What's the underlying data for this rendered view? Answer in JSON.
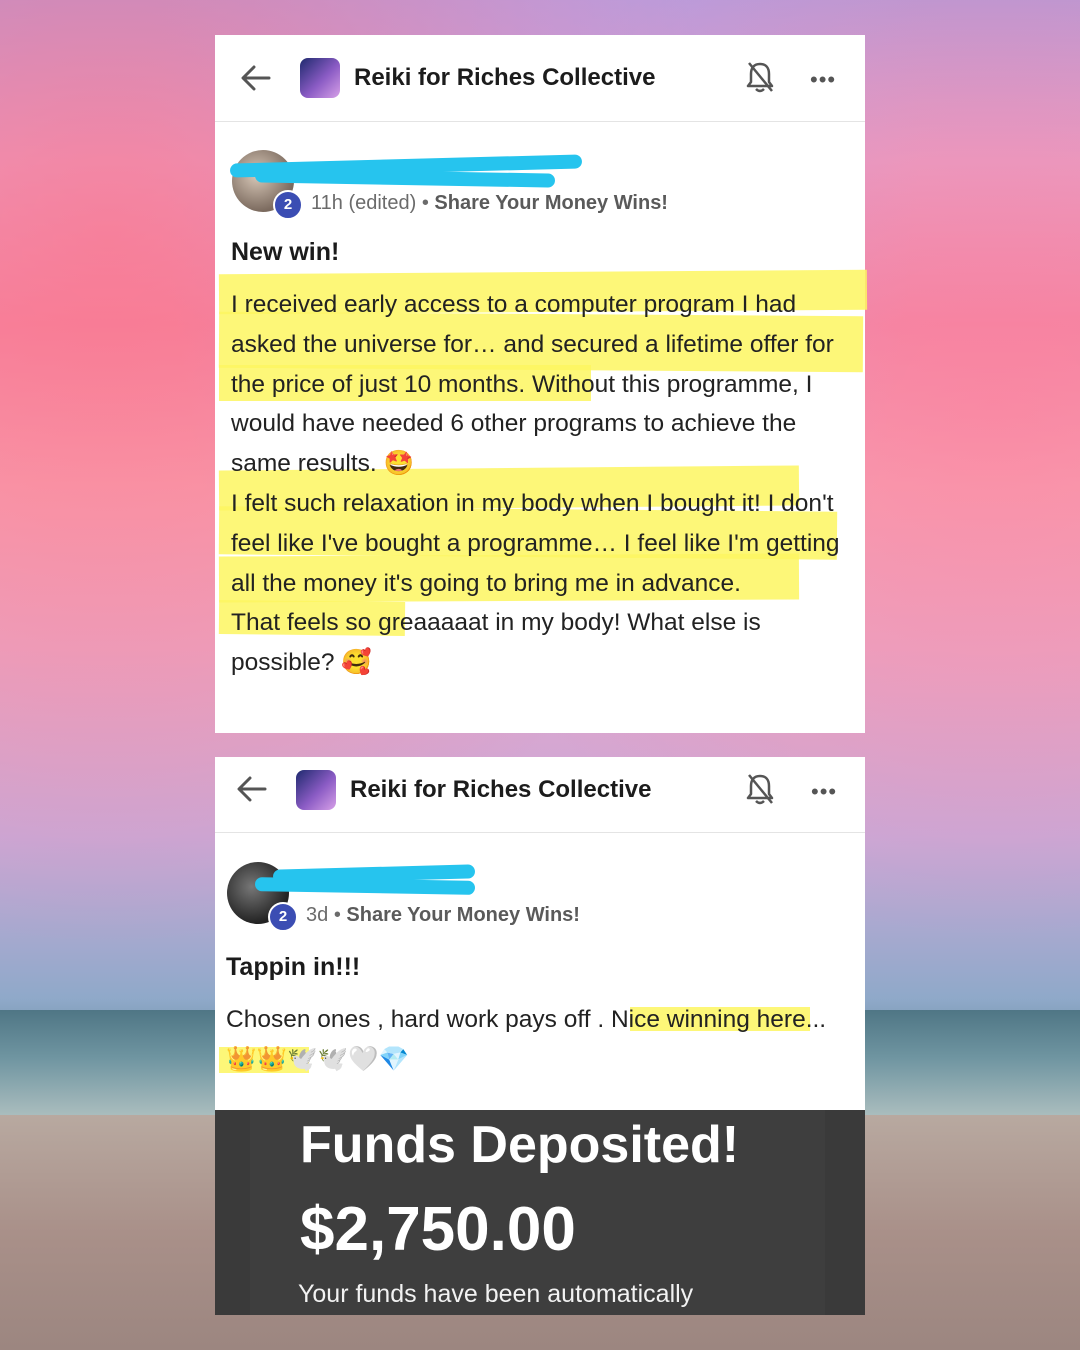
{
  "colors": {
    "accent": "#3b4db3",
    "highlight": "#fdf660",
    "scribble": "#26c4ee"
  },
  "post1": {
    "group_name": "Reiki for Riches Collective",
    "level": "2",
    "time": "11h (edited)",
    "separator": "•",
    "category": "Share Your Money Wins!",
    "title": "New win!",
    "paragraphs": [
      "I received early access to a computer program I had asked the universe for… and secured a lifetime offer for the price of just 10 months. Without this programme, I would have needed 6 other programs to achieve the same results. 🤩",
      "I felt such relaxation in my body when I bought it! I don't feel like I've bought a programme… I feel like I'm getting all the money it's going to bring me in advance.",
      "That feels so greaaaaat in my body! What else is possible? 🥰"
    ]
  },
  "post2": {
    "group_name": "Reiki for Riches Collective",
    "level": "2",
    "time": "3d",
    "separator": "•",
    "category": "Share Your Money Wins!",
    "title": "Tappin in!!!",
    "body": "Chosen ones , hard work pays off . Nice winning here... 👑👑🕊️🕊️🤍💎",
    "deposit": {
      "title": "Funds Deposited!",
      "amount": "$2,750.00",
      "text": "Your funds have been automatically"
    }
  },
  "icons": [
    "back-arrow-icon",
    "group-logo-icon",
    "bell-off-icon",
    "more-icon"
  ]
}
